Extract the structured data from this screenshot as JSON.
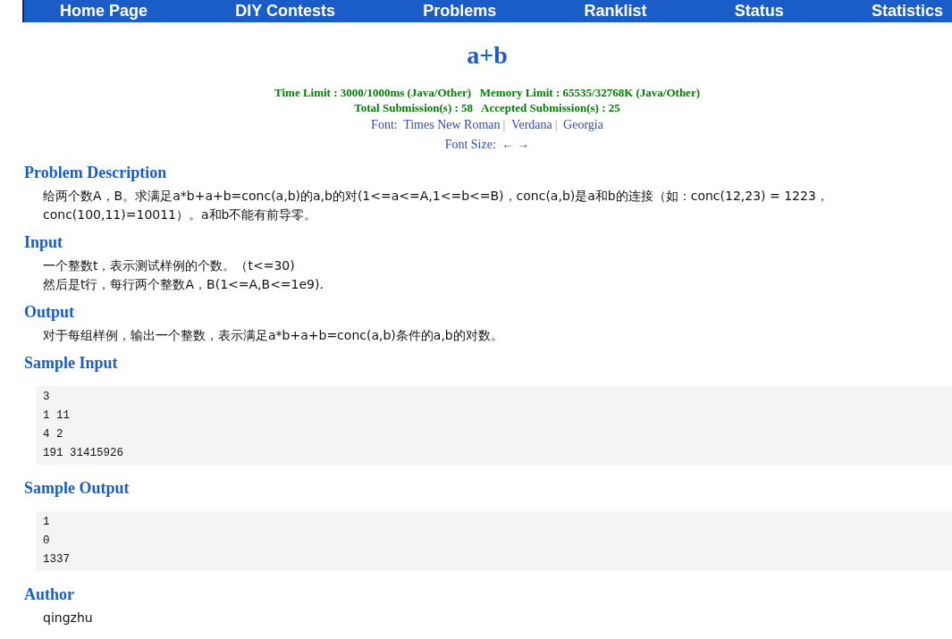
{
  "nav": [
    {
      "label": "Home Page"
    },
    {
      "label": "DIY Contests"
    },
    {
      "label": "Problems"
    },
    {
      "label": "Ranklist"
    },
    {
      "label": "Status"
    },
    {
      "label": "Statistics"
    }
  ],
  "title": "a+b",
  "limits": [
    "Time Limit : 3000/1000ms (Java/Other)   Memory Limit : 65535/32768K (Java/Other)",
    "Total Submission(s) : 58   Accepted Submission(s) : 25"
  ],
  "font_switch": {
    "label": "Font:",
    "separator": "|",
    "options": [
      "Times New Roman",
      "Verdana",
      "Georgia"
    ]
  },
  "font_size": {
    "label": "Font Size:",
    "controls": [
      "←",
      "→"
    ]
  },
  "sections": [
    {
      "kind": "text",
      "heading": "Problem Description",
      "lines": [
        "给两个数A，B。求满足a*b+a+b=conc(a,b)的a,b的对(1<=a<=A,1<=b<=B)，conc(a,b)是a和b的连接（如：conc(12,23) = 1223，",
        "conc(100,11)=10011）。a和b不能有前导零。"
      ]
    },
    {
      "kind": "text",
      "heading": "Input",
      "lines": [
        "一个整数t，表示测试样例的个数。（t<=30)",
        "然后是t行，每行两个整数A，B(1<=A,B<=1e9)."
      ]
    },
    {
      "kind": "text",
      "heading": "Output",
      "lines": [
        "对于每组样例，输出一个整数，表示满足a*b+a+b=conc(a,b)条件的a,b的对数。"
      ]
    },
    {
      "kind": "code",
      "heading": "Sample Input",
      "lines": [
        "3",
        "1 11",
        "4 2",
        "191 31415926"
      ]
    },
    {
      "kind": "code",
      "heading": "Sample Output",
      "lines": [
        "1",
        "0",
        "1337"
      ]
    },
    {
      "kind": "text",
      "heading": "Author",
      "lines": [
        "qingzhu"
      ]
    }
  ]
}
